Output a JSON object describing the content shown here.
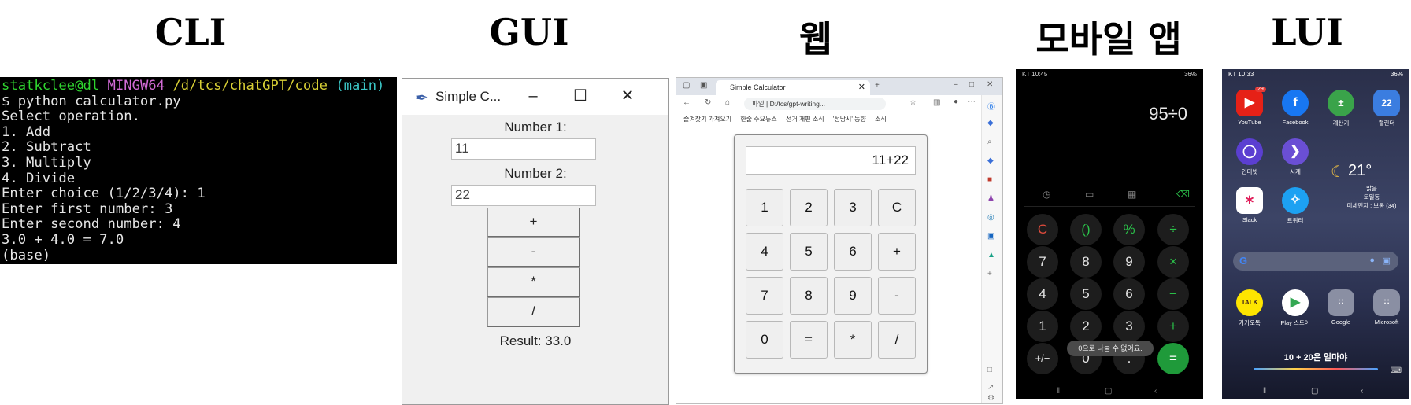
{
  "headings": {
    "cli": "CLI",
    "gui": "GUI",
    "web": "웹",
    "mobile": "모바일 앱",
    "lui": "LUI"
  },
  "cli": {
    "prompt_user": "statkclee@dl",
    "prompt_env": "MINGW64",
    "prompt_path": "/d/tcs/chatGPT/code",
    "prompt_branch": "(main)",
    "lines": [
      "$ python calculator.py",
      "Select operation.",
      "1. Add",
      "2. Subtract",
      "3. Multiply",
      "4. Divide",
      "Enter choice (1/2/3/4): 1",
      "Enter first number: 3",
      "Enter second number: 4",
      "3.0 + 4.0 = 7.0",
      "(base)"
    ]
  },
  "gui": {
    "title": "Simple C...",
    "label1": "Number 1:",
    "value1": "11",
    "label2": "Number 2:",
    "value2": "22",
    "buttons": [
      "+",
      "-",
      "*",
      "/"
    ],
    "result": "Result: 33.0"
  },
  "web": {
    "tab_title": "Simple Calculator",
    "url_prefix": "파일 |",
    "url": "D:/tcs/gpt-writing...",
    "bookmarks": [
      "즐겨찾기 가져오기",
      "한줄 주요뉴스",
      "선거 개편 소식",
      "'성남시' 동향",
      "소식"
    ],
    "display": "11+22",
    "keys": [
      "1",
      "2",
      "3",
      "C",
      "4",
      "5",
      "6",
      "+",
      "7",
      "8",
      "9",
      "-",
      "0",
      "=",
      "*",
      "/"
    ]
  },
  "mobile": {
    "status_left": "KT 10:45",
    "status_right": "36%",
    "expression": "95÷0",
    "keys": [
      "C",
      "()",
      "%",
      "÷",
      "7",
      "8",
      "9",
      "×",
      "4",
      "5",
      "6",
      "−",
      "1",
      "2",
      "3",
      "+",
      "+/−",
      "0",
      ".",
      "="
    ],
    "toast": "0으로 나눌 수 없어요."
  },
  "lui": {
    "status_left": "KT 10:33",
    "status_right": "36%",
    "apps_row1": [
      "YouTube",
      "Facebook",
      "계산기",
      "캘린더"
    ],
    "apps_row2": [
      "인터넷",
      "시계"
    ],
    "apps_row3": [
      "Slack",
      "트위터"
    ],
    "apps_row4": [
      "카카오톡",
      "Play 스토어",
      "Google",
      "Microsoft"
    ],
    "youtube_badge": "29",
    "calendar_day": "22",
    "weather_temp": "21°",
    "weather_desc": "맑음",
    "weather_loc": "토일동",
    "weather_air": "미세먼지 : 보통 (34)",
    "prompt": "10 + 20은 얼마야"
  },
  "colors": {
    "cli_bg": "#000000",
    "mobile_equals": "#1f9a3a",
    "mobile_op": "#2bc24a",
    "mobile_clear": "#e04b3c"
  }
}
